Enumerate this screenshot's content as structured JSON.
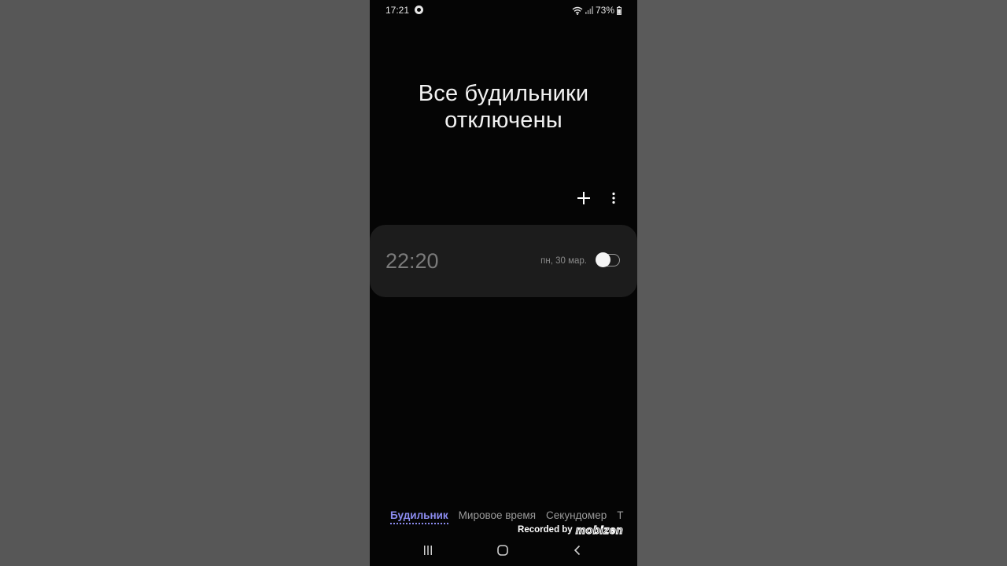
{
  "status_bar": {
    "time": "17:21",
    "app_icon": "mobizen-icon",
    "wifi_icon": "wifi-icon",
    "signal_icon": "signal-icon",
    "battery_text": "73%",
    "battery_icon": "battery-icon"
  },
  "headline": {
    "line1": "Все будильники",
    "line2": "отключены"
  },
  "toolbar": {
    "add_icon": "plus-icon",
    "more_icon": "more-vertical-icon"
  },
  "alarm": {
    "time": "22:20",
    "date": "пн, 30 мар.",
    "enabled": false
  },
  "tabs": [
    {
      "label": "Будильник",
      "active": true
    },
    {
      "label": "Мировое время",
      "active": false
    },
    {
      "label": "Секундомер",
      "active": false
    },
    {
      "label": "Т",
      "active": false
    }
  ],
  "watermark": {
    "prefix": "Recorded by",
    "logo": "mobizen"
  },
  "navbar": {
    "recents_icon": "recents-icon",
    "home_icon": "home-icon",
    "back_icon": "back-icon"
  },
  "colors": {
    "background": "#555555",
    "screen": "#050505",
    "card": "#1c1c1c",
    "accent": "#8c8cf0"
  }
}
